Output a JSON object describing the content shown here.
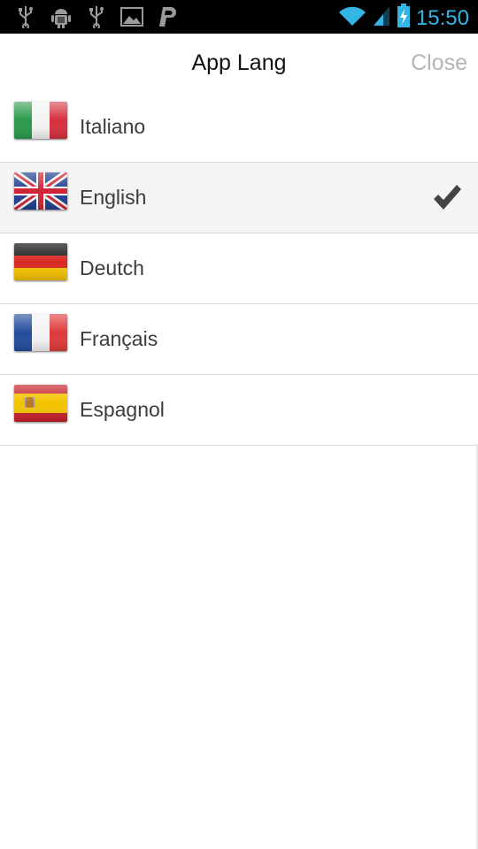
{
  "status_bar": {
    "time": "15:50",
    "left_icons": [
      "usb-icon",
      "android-debug-icon",
      "usb-icon",
      "image-icon",
      "paypal-icon"
    ],
    "right_icons": [
      "wifi-icon",
      "signal-icon",
      "battery-charging-icon"
    ],
    "accent_color": "#33b5e5"
  },
  "header": {
    "title": "App Lang",
    "close_label": "Close"
  },
  "languages": [
    {
      "label": "Italiano",
      "flag": "italy-flag-icon",
      "selected": false
    },
    {
      "label": "English",
      "flag": "uk-flag-icon",
      "selected": true
    },
    {
      "label": "Deutch",
      "flag": "germany-flag-icon",
      "selected": false
    },
    {
      "label": "Français",
      "flag": "france-flag-icon",
      "selected": false
    },
    {
      "label": "Espagnol",
      "flag": "spain-flag-icon",
      "selected": false
    }
  ]
}
